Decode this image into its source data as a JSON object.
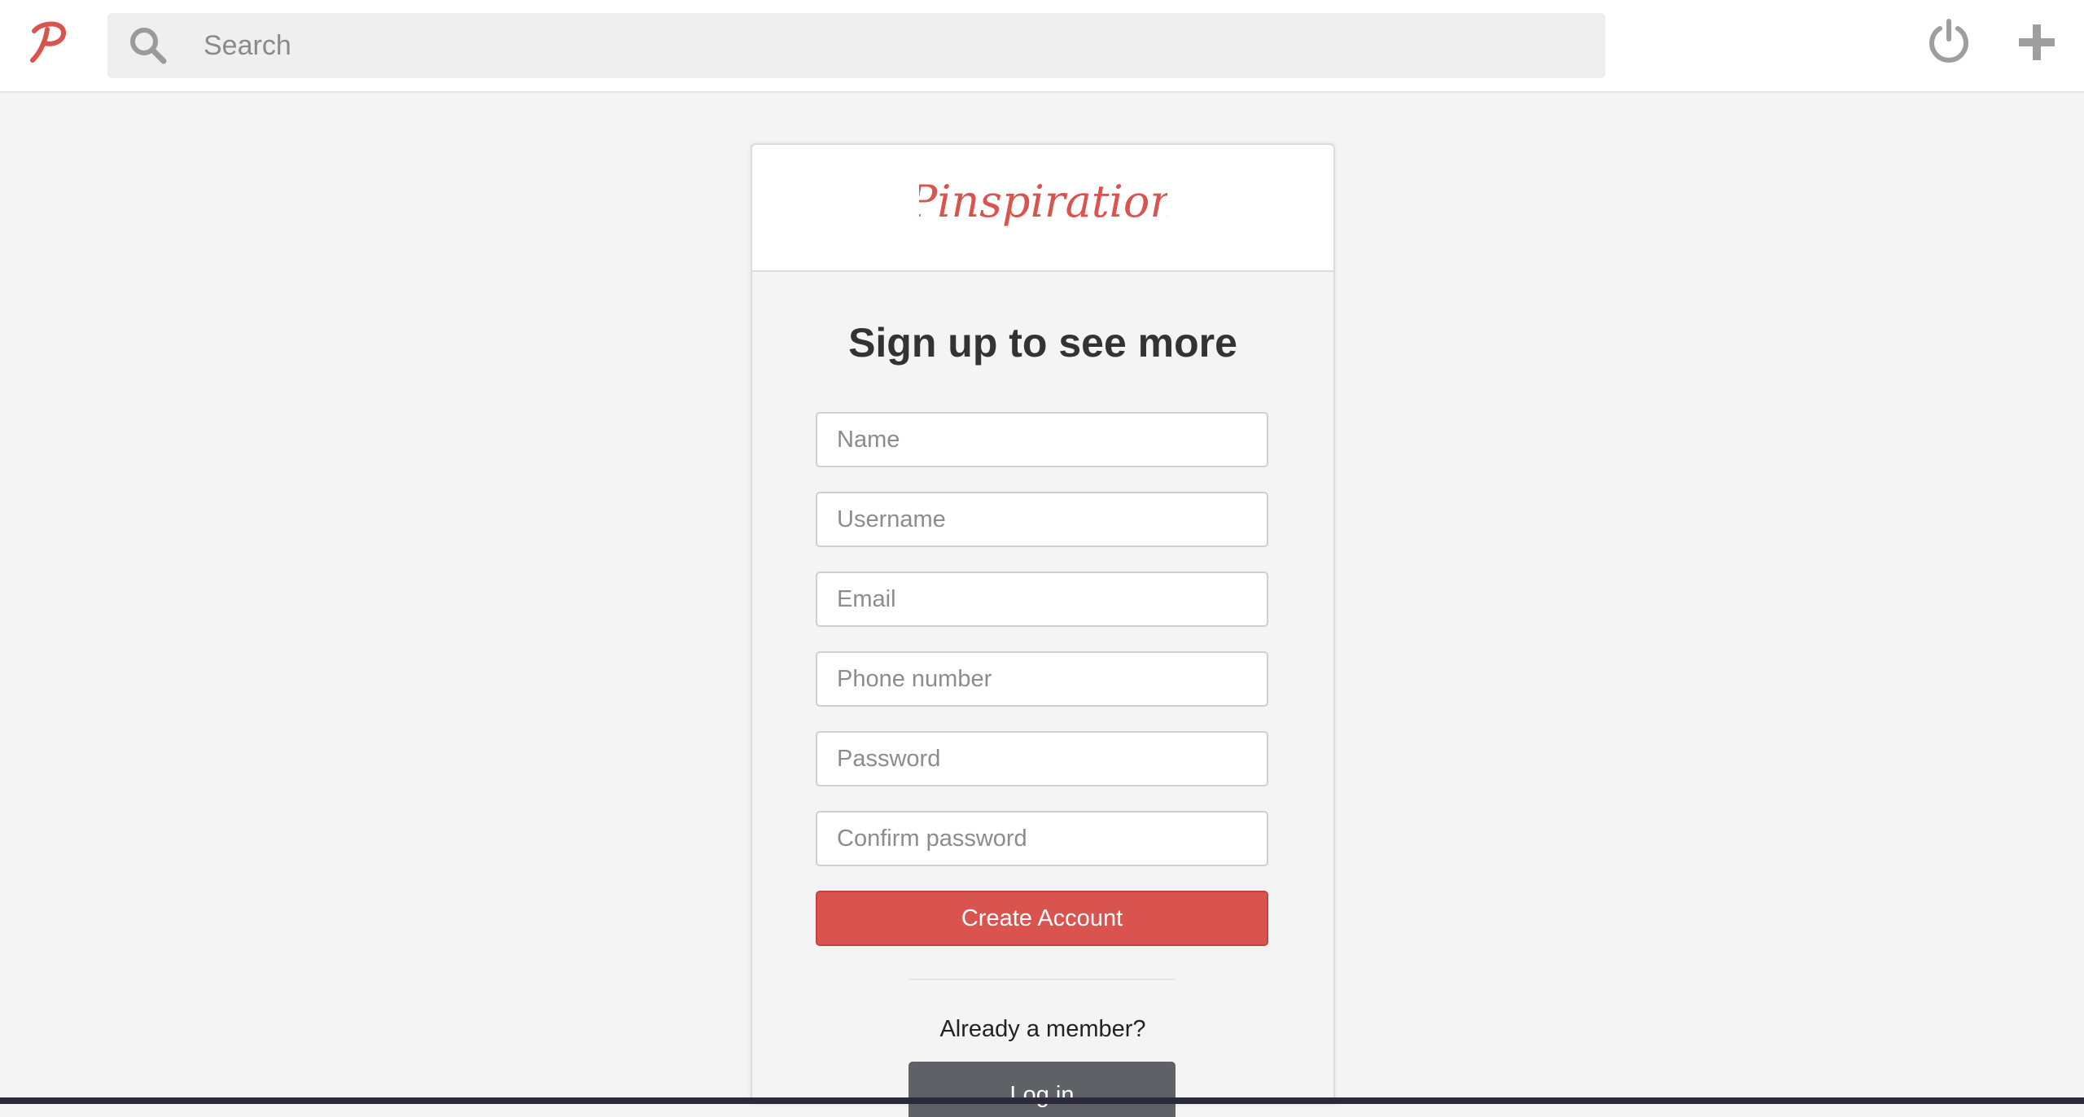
{
  "topbar": {
    "logo_icon": "pinspiration-p-logo-icon",
    "search": {
      "placeholder": "Search",
      "icon": "search-icon"
    },
    "power_icon": "power-icon",
    "add_icon": "plus-icon"
  },
  "card": {
    "brand": "Pinspiration",
    "heading": "Sign up to see more",
    "fields": {
      "name": "Name",
      "username": "Username",
      "email": "Email",
      "phone": "Phone number",
      "password": "Password",
      "confirm_password": "Confirm password"
    },
    "create_button": "Create Account",
    "member_prompt": "Already a member?",
    "login_button": "Log in"
  },
  "colors": {
    "brand_red": "#d9534f",
    "login_gray": "#5f6166",
    "background": "#f4f4f4"
  }
}
